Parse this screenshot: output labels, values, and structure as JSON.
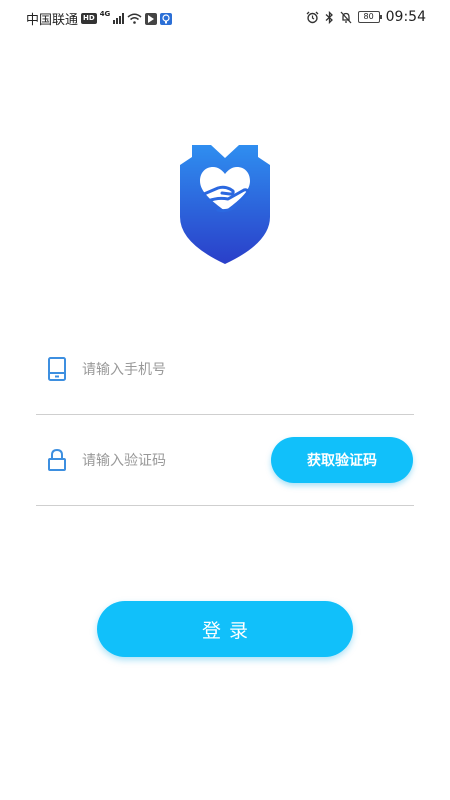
{
  "status_bar": {
    "carrier": "中国联通",
    "hd_badge": "HD",
    "network": "4G",
    "battery": "80",
    "time": "09:54"
  },
  "login_form": {
    "phone_placeholder": "请输入手机号",
    "code_placeholder": "请输入验证码",
    "get_code_label": "获取验证码",
    "login_label": "登录"
  },
  "colors": {
    "accent": "#11c0fa",
    "icon_blue": "#3d8fe0",
    "logo_top": "#2f8ef0",
    "logo_bottom": "#2a3fc9"
  },
  "icons": {
    "logo": "shield-heart-hand-icon",
    "phone_field": "mobile-phone-icon",
    "code_field": "lock-icon"
  }
}
